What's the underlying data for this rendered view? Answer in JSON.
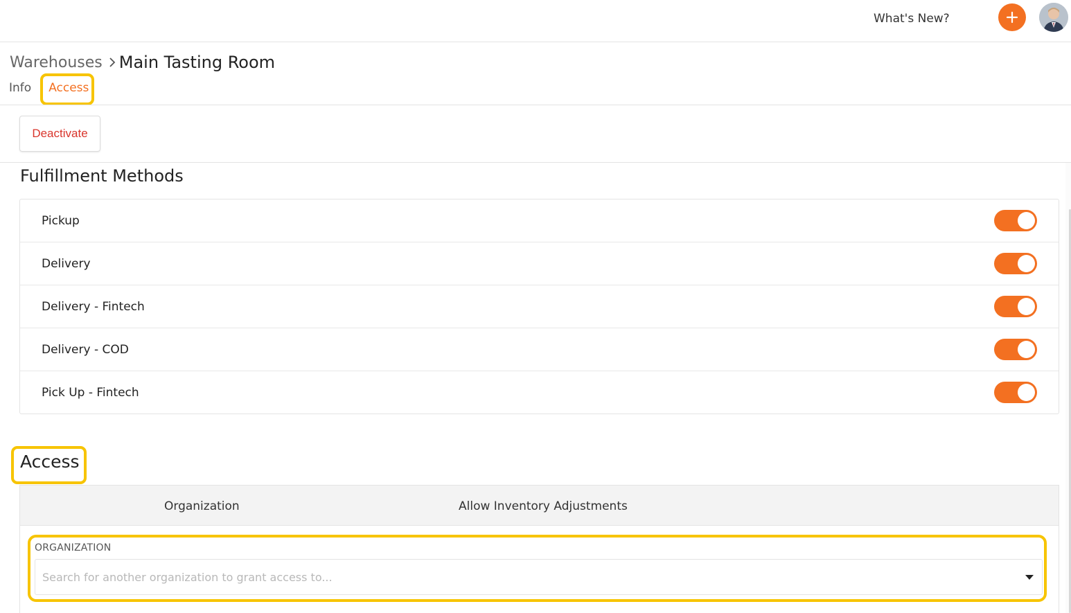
{
  "header": {
    "whats_new": "What's New?",
    "add_icon": "plus-icon",
    "avatar_icon": "user-avatar",
    "accent_color": "#f37021"
  },
  "breadcrumb": {
    "parent": "Warehouses",
    "separator_icon": "chevron-right-icon",
    "current": "Main Tasting Room"
  },
  "tabs": [
    {
      "label": "Info",
      "active": false
    },
    {
      "label": "Access",
      "active": true
    }
  ],
  "actions": {
    "deactivate_label": "Deactivate",
    "deactivate_color": "#d9352c"
  },
  "fulfillment": {
    "title": "Fulfillment Methods",
    "methods": [
      {
        "label": "Pickup",
        "enabled": true
      },
      {
        "label": "Delivery",
        "enabled": true
      },
      {
        "label": "Delivery - Fintech",
        "enabled": true
      },
      {
        "label": "Delivery - COD",
        "enabled": true
      },
      {
        "label": "Pick Up - Fintech",
        "enabled": true
      }
    ]
  },
  "access": {
    "title": "Access",
    "columns": [
      "Organization",
      "Allow Inventory Adjustments"
    ],
    "org_field_label": "ORGANIZATION",
    "org_placeholder": "Search for another organization to grant access to..."
  },
  "highlight_color": "#f7c400"
}
